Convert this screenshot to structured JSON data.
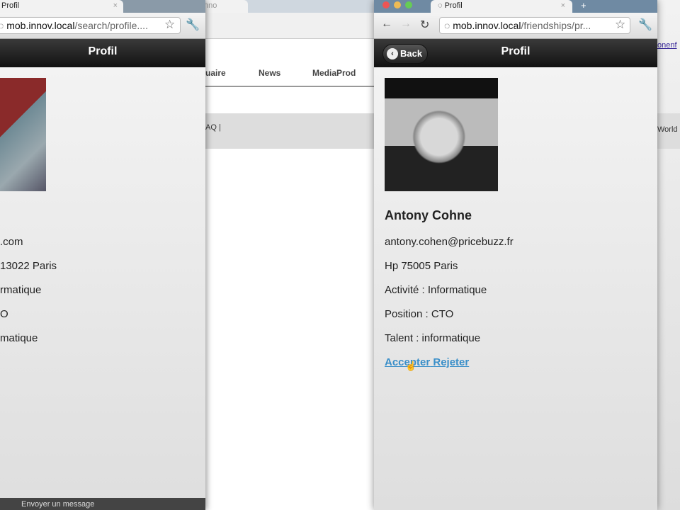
{
  "left_window": {
    "tab_title": "Profil",
    "url_host": "mob.innov.local",
    "url_path": "/search/profile....",
    "header_title": "Profil",
    "lines": [
      ".com",
      "13022 Paris",
      "rmatique",
      "O",
      "matique"
    ],
    "footer_text": "Envoyer un message"
  },
  "middle_page": {
    "tab_title": "nno",
    "nav": [
      "uaire",
      "News",
      "MediaProd"
    ],
    "footer_link": "AQ |"
  },
  "right_window": {
    "tab_title": "Profil",
    "url_host": "mob.innov.local",
    "url_path": "/friendships/pr...",
    "back_label": "Back",
    "header_title": "Profil",
    "name": "Antony Cohne",
    "email": "antony.cohen@pricebuzz.fr",
    "address": "Hp 75005 Paris",
    "activity": "Activité : Informatique",
    "position": "Position : CTO",
    "talent": "Talent : informatique",
    "accept_label": "Accepter",
    "reject_label": "Rejeter",
    "link_color": "#3a8fc9"
  },
  "far_right": {
    "link": "onenf",
    "text": "World"
  }
}
